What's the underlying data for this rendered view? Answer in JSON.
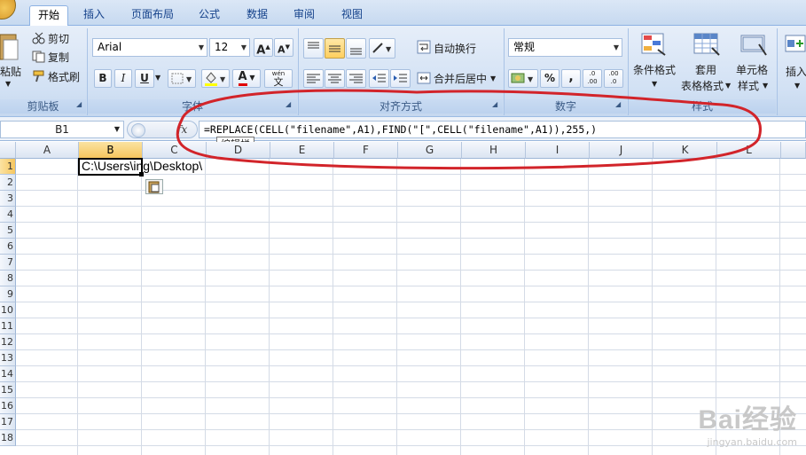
{
  "tabs": [
    "开始",
    "插入",
    "页面布局",
    "公式",
    "数据",
    "审阅",
    "视图"
  ],
  "clipboard": {
    "paste_label": "粘贴",
    "cut_label": "剪切",
    "copy_label": "复制",
    "format_painter_label": "格式刷",
    "group_label": "剪贴板"
  },
  "font": {
    "font_name": "Arial",
    "font_size": "12",
    "bold": "B",
    "italic": "I",
    "underline": "U",
    "grow_glyph": "A",
    "shrink_glyph": "A",
    "font_color_glyph": "A",
    "phonetic_glyph": "文",
    "phonetic_small": "wén",
    "group_label": "字体"
  },
  "alignment": {
    "wrap_text_label": "自动换行",
    "merge_center_label": "合并后居中",
    "group_label": "对齐方式"
  },
  "number": {
    "format_value": "常规",
    "percent_glyph": "%",
    "comma_glyph": ",",
    "inc_decimal_glyph": ".0 .00",
    "dec_decimal_glyph": ".00 .0",
    "group_label": "数字"
  },
  "styles": {
    "conditional_formatting_label": "条件格式",
    "table_format_line1": "套用",
    "table_format_line2": "表格格式",
    "cell_styles_line1": "单元格",
    "cell_styles_line2": "样式",
    "group_label": "样式"
  },
  "cells_group": {
    "insert_label": "插入"
  },
  "formula_bar": {
    "name_box": "B1",
    "fx_glyph": "fx",
    "formula": "=REPLACE(CELL(\"filename\",A1),FIND(\"[\",CELL(\"filename\",A1)),255,)",
    "tooltip": "编辑栏"
  },
  "sheet": {
    "columns": [
      "A",
      "B",
      "C",
      "D",
      "E",
      "F",
      "G",
      "H",
      "I",
      "J",
      "K",
      "L"
    ],
    "rows": [
      "1",
      "2",
      "3",
      "4",
      "5",
      "6",
      "7",
      "8",
      "9",
      "10",
      "11",
      "12",
      "13",
      "14",
      "15",
      "16",
      "17",
      "18"
    ],
    "cell_b1_text": "C:\\Users\\ing\\Desktop\\"
  },
  "watermark": {
    "brand": "Bai经验",
    "url": "jingyan.baidu.com"
  },
  "colors": {
    "ribbon_blue": "#d2e1f4",
    "annotation_red": "#d2242a",
    "selected_header": "#f6c65e"
  }
}
